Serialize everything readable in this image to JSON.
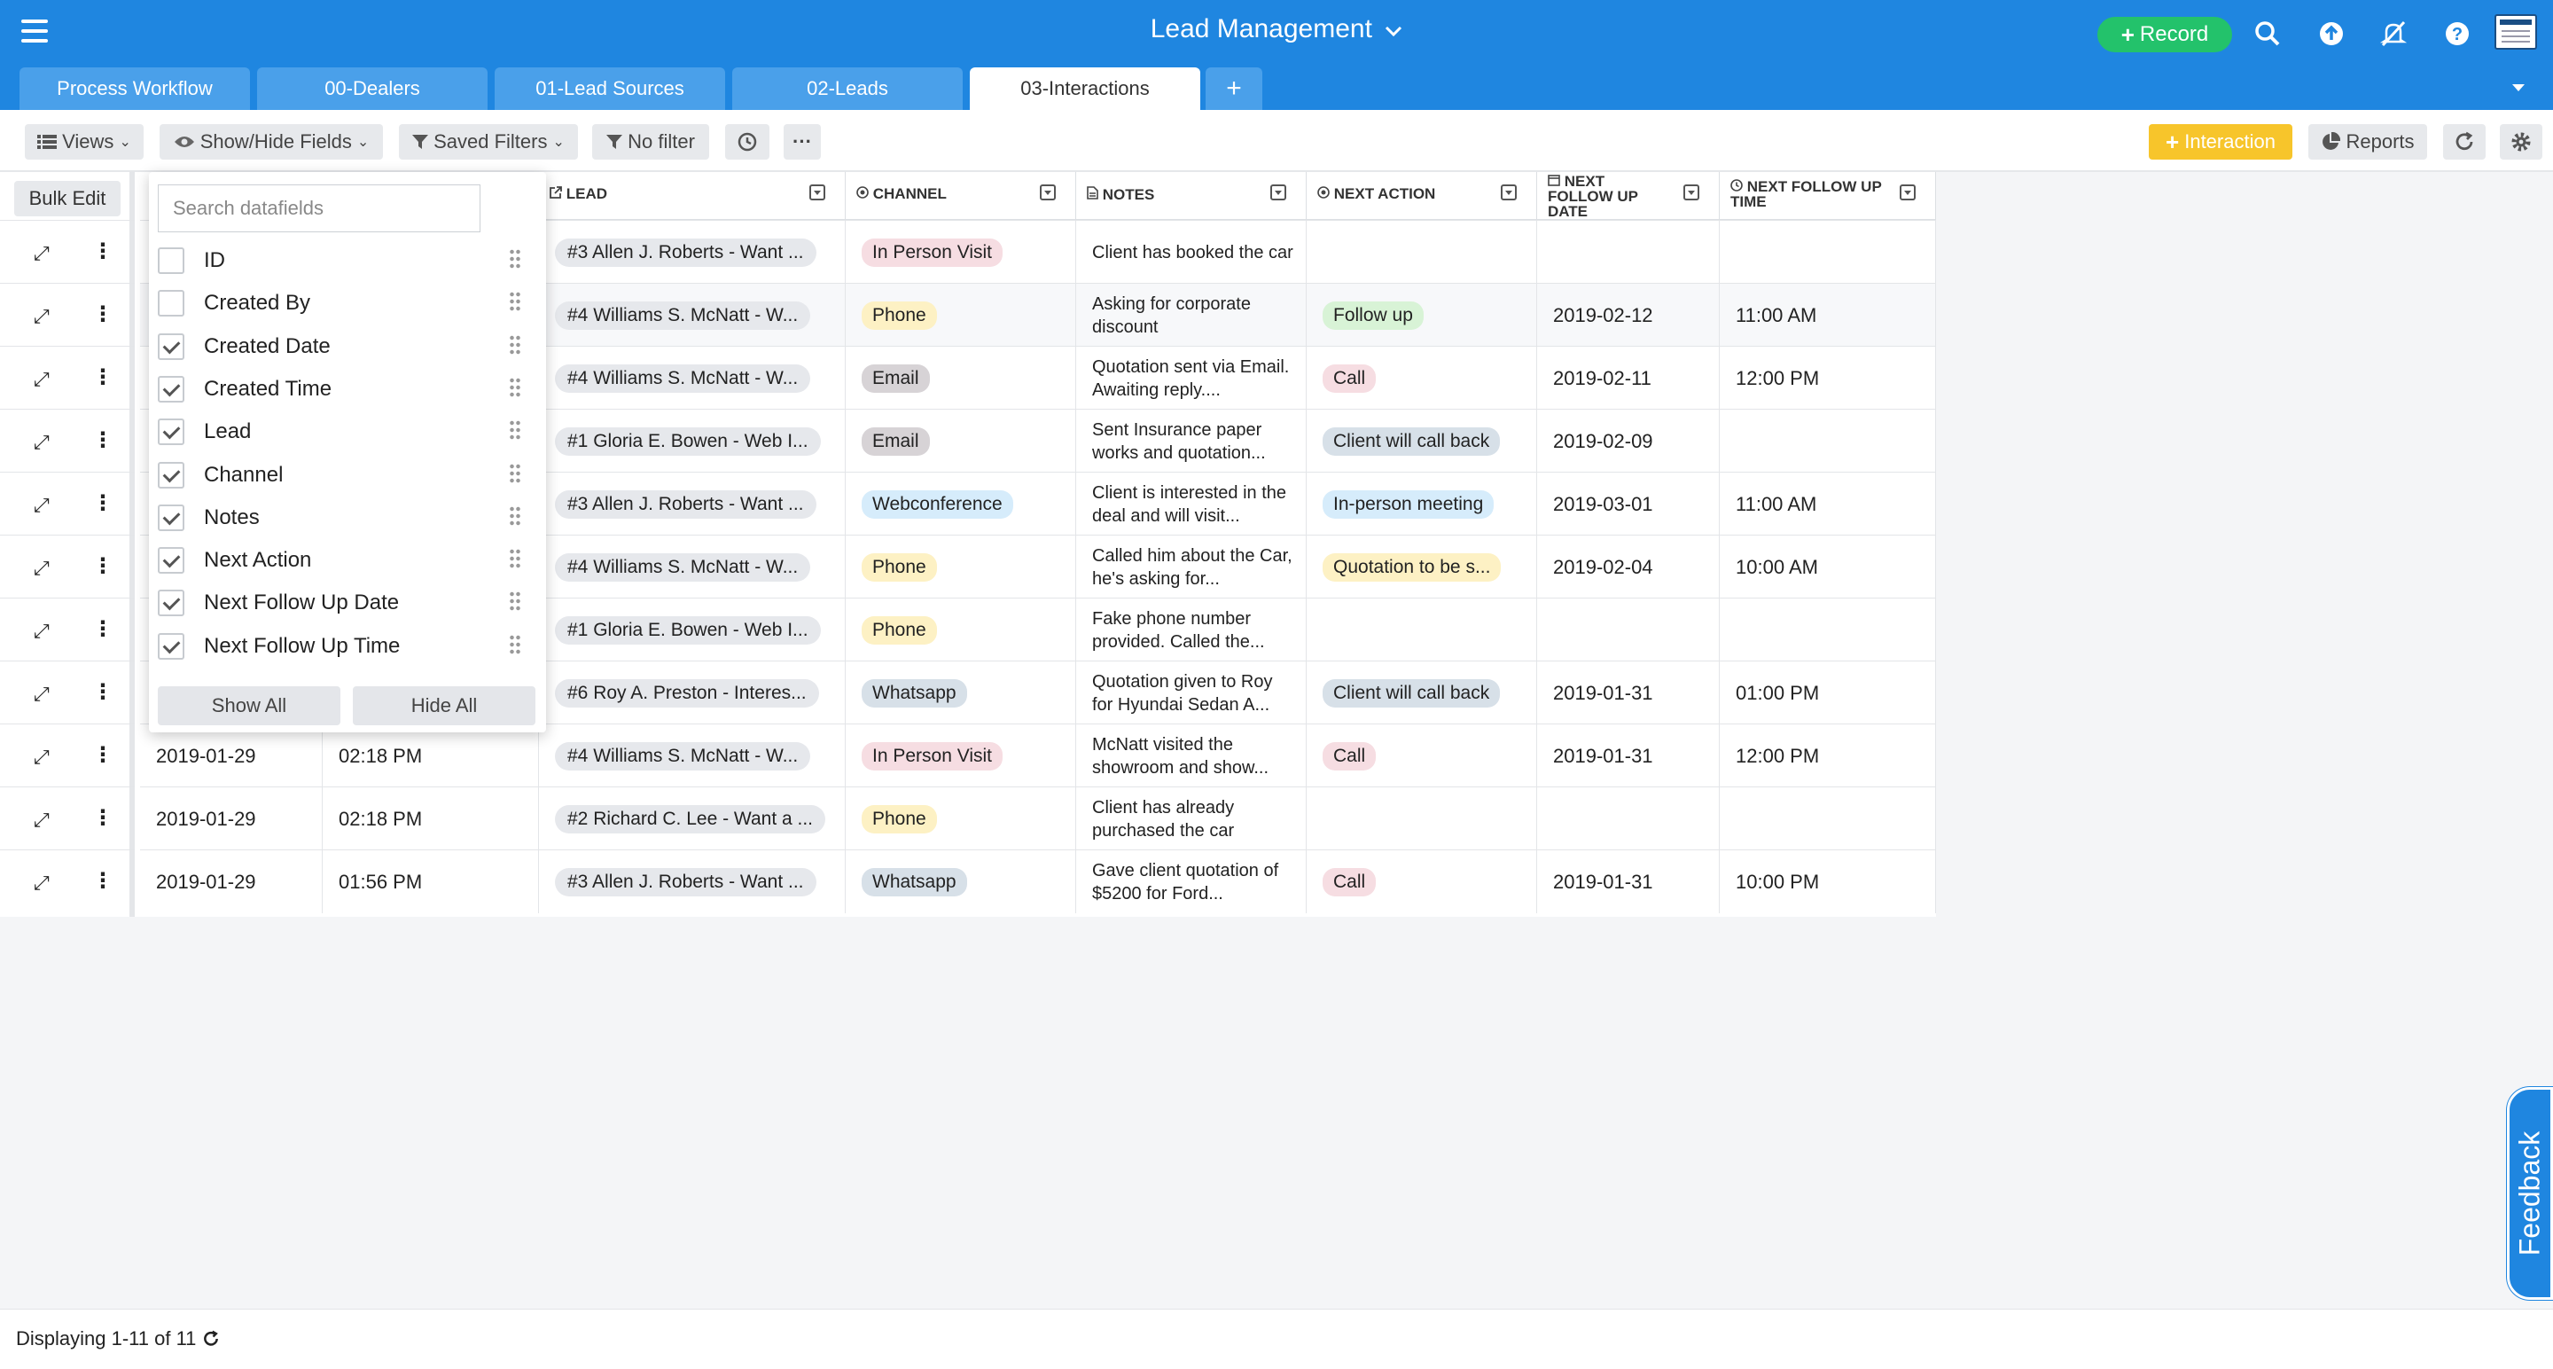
{
  "app": {
    "title": "Lead Management",
    "title_caret": "⌄"
  },
  "topbar": {
    "record_label": "Record",
    "plus": "+",
    "icons": [
      "search-icon",
      "upload-icon",
      "notifications-off-icon",
      "help-icon"
    ]
  },
  "tabs": [
    {
      "label": "Process Workflow"
    },
    {
      "label": "00-Dealers"
    },
    {
      "label": "01-Lead Sources"
    },
    {
      "label": "02-Leads"
    },
    {
      "label": "03-Interactions"
    }
  ],
  "tab_add": "+",
  "toolbar": {
    "views": "Views",
    "show_hide": "Show/Hide Fields",
    "saved_filters": "Saved Filters",
    "no_filter": "No filter",
    "more": "···",
    "interaction": "Interaction",
    "reports": "Reports"
  },
  "grid": {
    "bulk_edit": "Bulk Edit",
    "columns": [
      {
        "label": "LEAD"
      },
      {
        "label": "CHANNEL"
      },
      {
        "label": "NOTES"
      },
      {
        "label": "NEXT ACTION"
      },
      {
        "label": "NEXT FOLLOW UP DATE"
      },
      {
        "label": "NEXT FOLLOW UP TIME"
      }
    ],
    "rows": [
      {
        "date": "",
        "time": "",
        "lead": "#3 Allen J. Roberts - Want ...",
        "channel": "In Person Visit",
        "notes": "Client has booked the car",
        "next_action": "",
        "follow_date": "",
        "follow_time": ""
      },
      {
        "date": "",
        "time": "",
        "lead": "#4 Williams S. McNatt - W...",
        "channel": "Phone",
        "notes": "Asking for corporate discount",
        "next_action": "Follow up",
        "follow_date": "2019-02-12",
        "follow_time": "11:00 AM"
      },
      {
        "date": "",
        "time": "",
        "lead": "#4 Williams S. McNatt - W...",
        "channel": "Email",
        "notes": "Quotation sent via Email. Awaiting reply....",
        "next_action": "Call",
        "follow_date": "2019-02-11",
        "follow_time": "12:00 PM"
      },
      {
        "date": "",
        "time": "",
        "lead": "#1 Gloria E. Bowen - Web I...",
        "channel": "Email",
        "notes": "Sent Insurance paper works and quotation...",
        "next_action": "Client will call back",
        "follow_date": "2019-02-09",
        "follow_time": ""
      },
      {
        "date": "",
        "time": "",
        "lead": "#3 Allen J. Roberts - Want ...",
        "channel": "Webconference",
        "notes": "Client is interested in the deal and will visit...",
        "next_action": "In-person meeting",
        "follow_date": "2019-03-01",
        "follow_time": "11:00 AM"
      },
      {
        "date": "",
        "time": "",
        "lead": "#4 Williams S. McNatt - W...",
        "channel": "Phone",
        "notes": "Called him about the Car, he's asking for...",
        "next_action": "Quotation to be s...",
        "follow_date": "2019-02-04",
        "follow_time": "10:00 AM"
      },
      {
        "date": "",
        "time": "",
        "lead": "#1 Gloria E. Bowen - Web I...",
        "channel": "Phone",
        "notes": "Fake phone number provided. Called the...",
        "next_action": "",
        "follow_date": "",
        "follow_time": ""
      },
      {
        "date": "",
        "time": "",
        "lead": "#6 Roy A. Preston - Interes...",
        "channel": "Whatsapp",
        "notes": "Quotation given to Roy for Hyundai Sedan A...",
        "next_action": "Client will call back",
        "follow_date": "2019-01-31",
        "follow_time": "01:00 PM"
      },
      {
        "date": "2019-01-29",
        "time": "02:18 PM",
        "lead": "#4 Williams S. McNatt - W...",
        "channel": "In Person Visit",
        "notes": "McNatt visited the showroom and show...",
        "next_action": "Call",
        "follow_date": "2019-01-31",
        "follow_time": "12:00 PM"
      },
      {
        "date": "2019-01-29",
        "time": "02:18 PM",
        "lead": "#2 Richard C. Lee - Want a ...",
        "channel": "Phone",
        "notes": "Client has already purchased the car",
        "next_action": "",
        "follow_date": "",
        "follow_time": ""
      },
      {
        "date": "2019-01-29",
        "time": "01:56 PM",
        "lead": "#3 Allen J. Roberts - Want ...",
        "channel": "Whatsapp",
        "notes": "Gave client quotation of $5200 for Ford...",
        "next_action": "Call",
        "follow_date": "2019-01-31",
        "follow_time": "10:00 PM"
      }
    ]
  },
  "pill_colors": {
    "In Person Visit": "#f6dde2",
    "Phone": "#fdf1c4",
    "Email": "#d7d3d6",
    "Webconference": "#d6ecfb",
    "Whatsapp": "#d7e0e8",
    "Follow up": "#d8f3d6",
    "Call": "#f6dde2",
    "Client will call back": "#d7e0e8",
    "In-person meeting": "#d6ecfb",
    "Quotation to be s...": "#fdf1c4"
  },
  "fields_dropdown": {
    "search_placeholder": "Search datafields",
    "fields": [
      {
        "label": "ID",
        "checked": false
      },
      {
        "label": "Created By",
        "checked": false
      },
      {
        "label": "Created Date",
        "checked": true
      },
      {
        "label": "Created Time",
        "checked": true
      },
      {
        "label": "Lead",
        "checked": true
      },
      {
        "label": "Channel",
        "checked": true
      },
      {
        "label": "Notes",
        "checked": true
      },
      {
        "label": "Next Action",
        "checked": true
      },
      {
        "label": "Next Follow Up Date",
        "checked": true
      },
      {
        "label": "Next Follow Up Time",
        "checked": true
      }
    ],
    "show_all": "Show All",
    "hide_all": "Hide All"
  },
  "footer": {
    "status": "Displaying 1-11 of 11"
  },
  "feedback": "Feedback",
  "colors": {
    "brand": "#1f86e0",
    "record": "#23c26b",
    "accent_yellow": "#f7c52b"
  }
}
